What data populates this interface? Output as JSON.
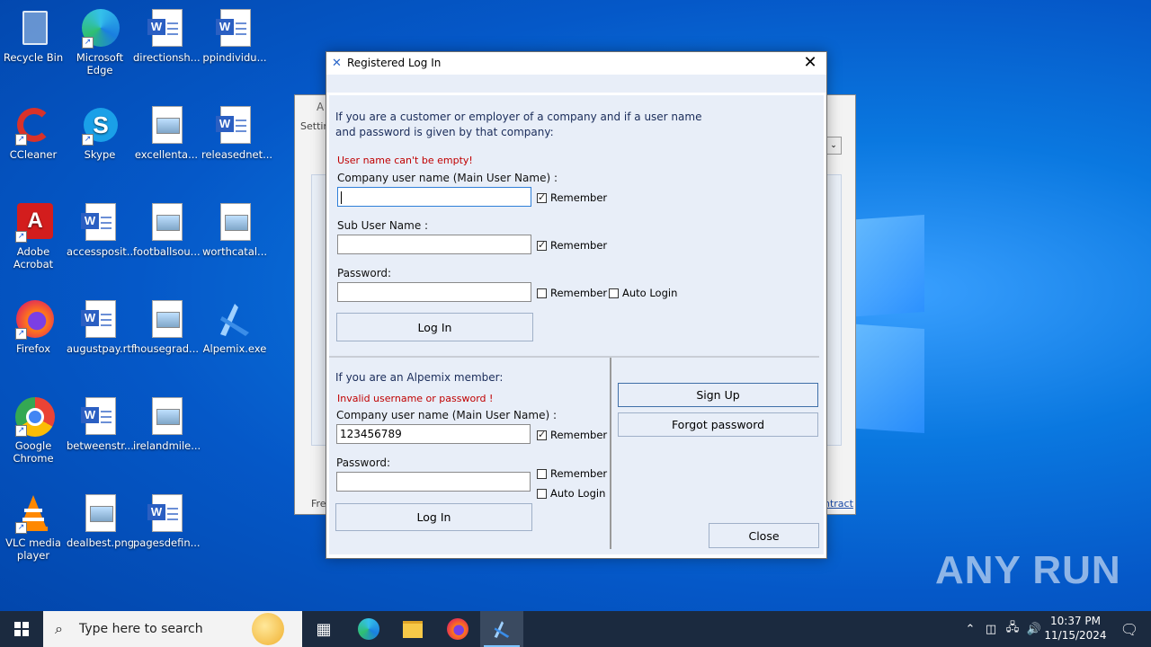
{
  "desktop": {
    "icons": [
      {
        "label": "Recycle Bin"
      },
      {
        "label": "Microsoft Edge"
      },
      {
        "label": "directionsh..."
      },
      {
        "label": "ppindividu..."
      },
      {
        "label": "CCleaner"
      },
      {
        "label": "Skype"
      },
      {
        "label": "excellenta..."
      },
      {
        "label": "releasednet..."
      },
      {
        "label": "Adobe Acrobat"
      },
      {
        "label": "accessposit..."
      },
      {
        "label": "footballsou..."
      },
      {
        "label": "worthcatal..."
      },
      {
        "label": "Firefox"
      },
      {
        "label": "augustpay.rtf"
      },
      {
        "label": "housegrad..."
      },
      {
        "label": "Alpemix.exe"
      },
      {
        "label": "Google Chrome"
      },
      {
        "label": "betweenstr..."
      },
      {
        "label": "irelandmile..."
      },
      {
        "label": "VLC media player"
      },
      {
        "label": "dealbest.png"
      },
      {
        "label": "pagesdefin..."
      }
    ]
  },
  "background_window": {
    "title": "A",
    "menu": "Settin",
    "footer_left": "Fre",
    "footer_right": "ntract"
  },
  "dialog": {
    "title": "Registered Log In",
    "close_glyph": "✕",
    "company_section": {
      "intro": "If you are a customer or employer of a company and if a user name and password is given by that company:",
      "error": "User name can't be empty!",
      "company_user_label": "Company user name (Main User Name) :",
      "company_user_value": "",
      "sub_user_label": "Sub User Name :",
      "sub_user_value": "",
      "password_label": "Password:",
      "password_value": "",
      "remember_label": "Remember",
      "auto_login_label": "Auto Login",
      "login_button": "Log In"
    },
    "member_section": {
      "intro": "If you are an Alpemix member:",
      "error": "Invalid username or password !",
      "company_user_label": "Company user name (Main User Name) :",
      "company_user_value": "123456789",
      "password_label": "Password:",
      "password_value": "",
      "remember_label": "Remember",
      "auto_login_label": "Auto Login",
      "login_button": "Log In",
      "sign_up_button": "Sign Up",
      "forgot_button": "Forgot password",
      "close_button": "Close"
    }
  },
  "taskbar": {
    "search_placeholder": "Type here to search",
    "time": "10:37 PM",
    "date": "11/15/2024"
  },
  "watermark": "ANY RUN",
  "colors": {
    "desktop_blue": "#0a78e0",
    "dialog_panel": "#e8eef8",
    "error_red": "#c00000",
    "taskbar": "#1b2a3f"
  }
}
